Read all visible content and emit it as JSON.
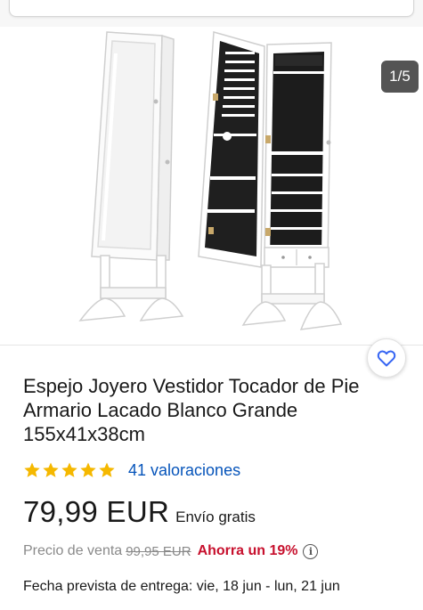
{
  "gallery": {
    "counter": "1/5",
    "image_alt": "Espejo joyero blanco de pie, cerrado y abierto"
  },
  "product": {
    "title": "Espejo Joyero Vestidor Tocador de Pie Armario Lacado Blanco Grande 155x41x38cm",
    "rating_stars": 5,
    "reviews_label": "41 valoraciones",
    "price": "79,99 EUR",
    "shipping": "Envío gratis",
    "was_label": "Precio de venta",
    "was_price": "99,95 EUR",
    "savings": "Ahorra un 19%",
    "info_glyph": "i",
    "delivery": "Fecha prevista de entrega: vie, 18 jun - lun, 21 jun"
  },
  "icons": {
    "favorite": "heart-outline-icon",
    "info": "info-circle-icon",
    "star": "star-filled-icon"
  },
  "colors": {
    "link": "#0654ba",
    "savings": "#c7102d",
    "star": "#f5b800",
    "favorite": "#3665f3",
    "counter_bg": "#545454"
  }
}
